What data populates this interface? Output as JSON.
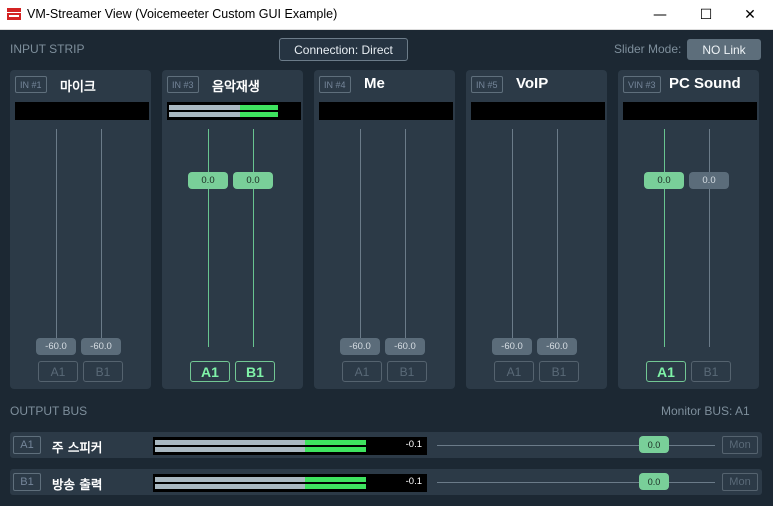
{
  "window": {
    "title": "VM-Streamer View (Voicemeeter Custom GUI Example)",
    "minimize": "—",
    "maximize": "☐",
    "close": "✕"
  },
  "header": {
    "input_strip_label": "INPUT STRIP",
    "connection_label": "Connection: Direct",
    "slider_mode_label": "Slider Mode:",
    "slider_mode_value": "NO Link"
  },
  "strips": [
    {
      "tag": "IN #1",
      "name": "마이크",
      "left_value": "-60.0",
      "right_value": "-60.0",
      "left_level": 0.0,
      "right_level": 0.0,
      "meter": [
        0,
        0
      ],
      "a1": "A1",
      "b1": "B1",
      "a1_on": false,
      "b1_on": false
    },
    {
      "tag": "IN #3",
      "name": "음악재생",
      "left_value": "0.0",
      "right_value": "0.0",
      "left_level": 1.0,
      "right_level": 1.0,
      "meter": [
        0.84,
        0.84
      ],
      "a1": "A1",
      "b1": "B1",
      "a1_on": true,
      "b1_on": true
    },
    {
      "tag": "IN #4",
      "name": "Me",
      "left_value": "-60.0",
      "right_value": "-60.0",
      "left_level": 0.0,
      "right_level": 0.0,
      "meter": [
        0,
        0
      ],
      "a1": "A1",
      "b1": "B1",
      "a1_on": false,
      "b1_on": false
    },
    {
      "tag": "IN #5",
      "name": "VoIP",
      "left_value": "-60.0",
      "right_value": "-60.0",
      "left_level": 0.0,
      "right_level": 0.0,
      "meter": [
        0,
        0
      ],
      "a1": "A1",
      "b1": "B1",
      "a1_on": false,
      "b1_on": false
    },
    {
      "tag": "VIN #3",
      "name": "PC Sound",
      "left_value": "0.0",
      "right_value": "0.0",
      "left_level": 1.0,
      "right_level": 1.0,
      "meter": [
        0,
        0
      ],
      "a1": "A1",
      "b1": "B1",
      "a1_on": true,
      "b1_on": false
    }
  ],
  "output": {
    "section_label": "OUTPUT BUS",
    "monitor_label": "Monitor BUS: A1",
    "buses": [
      {
        "tag": "A1",
        "name": "주 스피커",
        "db": "-0.1",
        "slider_value": "0.0",
        "mon": "Mon",
        "level": 0.78
      },
      {
        "tag": "B1",
        "name": "방송 출력",
        "db": "-0.1",
        "slider_value": "0.0",
        "mon": "Mon",
        "level": 0.78
      }
    ]
  },
  "colors": {
    "meter_gray": "#a9b8c1",
    "meter_green": "#3ee35f",
    "accent_green": "#79cf99"
  }
}
